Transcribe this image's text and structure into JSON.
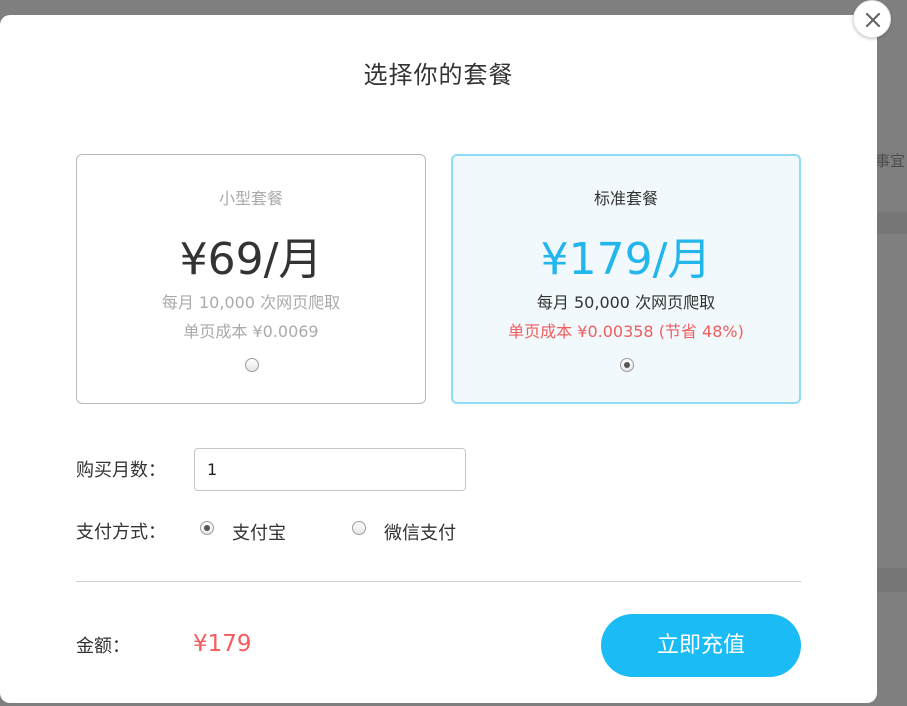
{
  "modal": {
    "title": "选择你的套餐",
    "close_icon": "close-icon"
  },
  "plans": [
    {
      "name": "小型套餐",
      "price": "¥69/月",
      "desc": "每月 10,000 次网页爬取",
      "cost": "单页成本 ¥0.0069",
      "selected": false
    },
    {
      "name": "标准套餐",
      "price": "¥179/月",
      "desc": "每月 50,000 次网页爬取",
      "cost": "单页成本 ¥0.00358 (节省 48%)",
      "selected": true
    }
  ],
  "form": {
    "months_label": "购买月数：",
    "months_value": "1",
    "payment_label": "支付方式：",
    "payment_options": [
      {
        "label": "支付宝",
        "selected": true
      },
      {
        "label": "微信支付",
        "selected": false
      }
    ]
  },
  "footer": {
    "amount_label": "金额：",
    "amount_value": "¥179",
    "recharge_label": "立即充值"
  },
  "background": {
    "partial_text": "事宜"
  },
  "colors": {
    "accent": "#1bbcf5",
    "price_accent": "#22b6ec",
    "warning": "#f25d5d",
    "selected_card_bg": "#f1f9fd",
    "selected_card_border": "#8fdcf6"
  }
}
